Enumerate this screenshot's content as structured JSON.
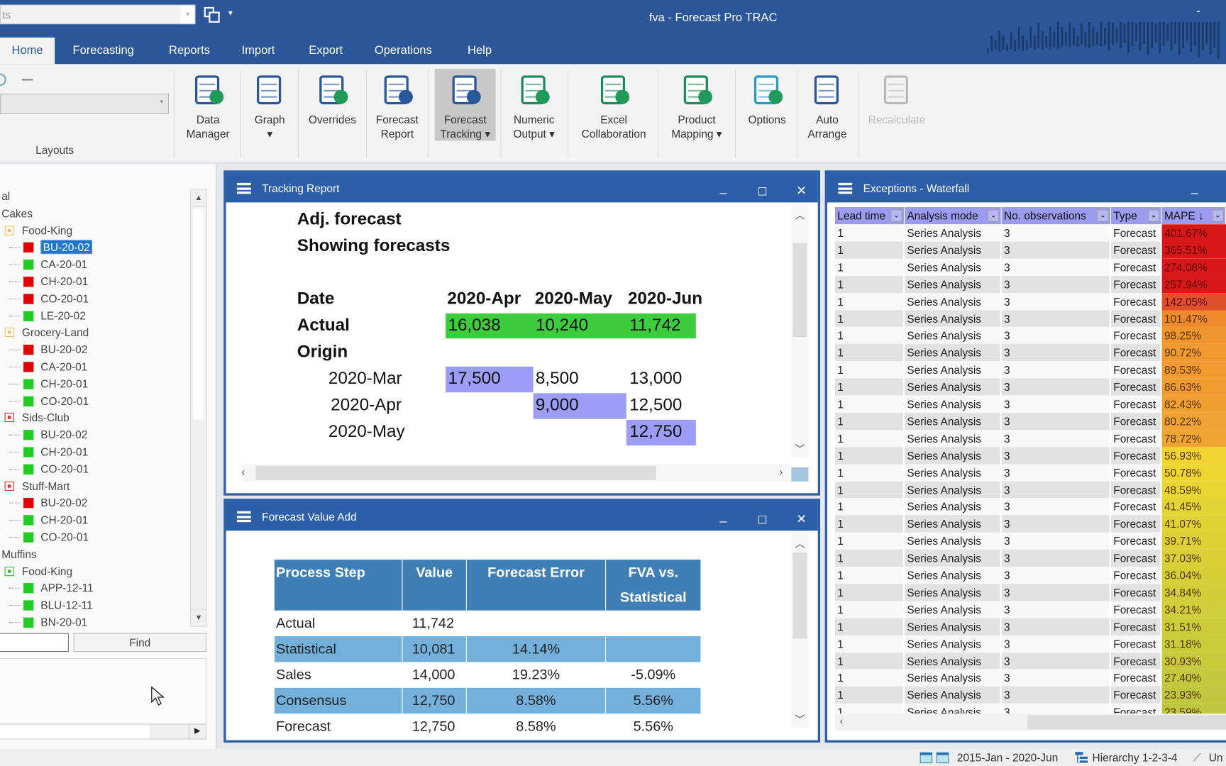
{
  "app": {
    "title": "fva - Forecast Pro TRAC",
    "quick_combo": "ts",
    "minimize": "-"
  },
  "tabs": [
    "Home",
    "Forecasting",
    "Reports",
    "Import",
    "Export",
    "Operations",
    "Help"
  ],
  "ribbon": {
    "group_label": "Layouts",
    "buttons": [
      {
        "l1": "Data",
        "l2": "Manager",
        "icon": "database-add-icon"
      },
      {
        "l1": "Graph",
        "l2": "▾",
        "icon": "bar-chart-icon"
      },
      {
        "l1": "Overrides",
        "l2": "",
        "icon": "table-edit-icon"
      },
      {
        "l1": "Forecast",
        "l2": "Report",
        "icon": "document-info-icon"
      },
      {
        "l1": "Forecast",
        "l2": "Tracking ▾",
        "icon": "table-clock-icon"
      },
      {
        "l1": "Numeric",
        "l2": "Output ▾",
        "icon": "document-arrow-icon"
      },
      {
        "l1": "Excel",
        "l2": "Collaboration",
        "icon": "excel-icon"
      },
      {
        "l1": "Product",
        "l2": "Mapping ▾",
        "icon": "hierarchy-map-icon"
      },
      {
        "l1": "Options",
        "l2": "",
        "icon": "gear-icon"
      },
      {
        "l1": "Auto",
        "l2": "Arrange",
        "icon": "windows-arrange-icon"
      },
      {
        "l1": "Recalculate",
        "l2": "",
        "icon": "refresh-icon"
      }
    ]
  },
  "tree": {
    "items": [
      {
        "label": "al",
        "level": 0,
        "kind": "text"
      },
      {
        "label": "Cakes",
        "level": 0,
        "kind": "text"
      },
      {
        "label": "Food-King",
        "level": 1,
        "kind": "group",
        "color": "#f0c060"
      },
      {
        "label": "BU-20-02",
        "level": 2,
        "kind": "leaf",
        "color": "#e00000",
        "selected": true
      },
      {
        "label": "CA-20-01",
        "level": 2,
        "kind": "leaf",
        "color": "#22cc22"
      },
      {
        "label": "CH-20-01",
        "level": 2,
        "kind": "leaf",
        "color": "#e00000"
      },
      {
        "label": "CO-20-01",
        "level": 2,
        "kind": "leaf",
        "color": "#e00000"
      },
      {
        "label": "LE-20-02",
        "level": 2,
        "kind": "leaf",
        "color": "#22cc22"
      },
      {
        "label": "Grocery-Land",
        "level": 1,
        "kind": "group",
        "color": "#f0c060"
      },
      {
        "label": "BU-20-02",
        "level": 2,
        "kind": "leaf",
        "color": "#e00000"
      },
      {
        "label": "CA-20-01",
        "level": 2,
        "kind": "leaf",
        "color": "#e00000"
      },
      {
        "label": "CH-20-01",
        "level": 2,
        "kind": "leaf",
        "color": "#22cc22"
      },
      {
        "label": "CO-20-01",
        "level": 2,
        "kind": "leaf",
        "color": "#22cc22"
      },
      {
        "label": "Sids-Club",
        "level": 1,
        "kind": "group",
        "color": "#e03030"
      },
      {
        "label": "BU-20-02",
        "level": 2,
        "kind": "leaf",
        "color": "#22cc22"
      },
      {
        "label": "CH-20-01",
        "level": 2,
        "kind": "leaf",
        "color": "#22cc22"
      },
      {
        "label": "CO-20-01",
        "level": 2,
        "kind": "leaf",
        "color": "#22cc22"
      },
      {
        "label": "Stuff-Mart",
        "level": 1,
        "kind": "group",
        "color": "#e03030"
      },
      {
        "label": "BU-20-02",
        "level": 2,
        "kind": "leaf",
        "color": "#e00000"
      },
      {
        "label": "CH-20-01",
        "level": 2,
        "kind": "leaf",
        "color": "#22cc22"
      },
      {
        "label": "CO-20-01",
        "level": 2,
        "kind": "leaf",
        "color": "#22cc22"
      },
      {
        "label": "Muffins",
        "level": 0,
        "kind": "text"
      },
      {
        "label": "Food-King",
        "level": 1,
        "kind": "group",
        "color": "#30c030"
      },
      {
        "label": "APP-12-11",
        "level": 2,
        "kind": "leaf",
        "color": "#22cc22"
      },
      {
        "label": "BLU-12-11",
        "level": 2,
        "kind": "leaf",
        "color": "#22cc22"
      },
      {
        "label": "BN-20-01",
        "level": 2,
        "kind": "leaf",
        "color": "#22cc22"
      }
    ],
    "find_label": "Find",
    "find_value": ""
  },
  "tracking": {
    "title": "Tracking Report",
    "line1": "Adj. forecast",
    "line2": "Showing forecasts",
    "date_label": "Date",
    "dates": [
      "2020-Apr",
      "2020-May",
      "2020-Jun"
    ],
    "actual_label": "Actual",
    "actual": [
      "16,038",
      "10,240",
      "11,742"
    ],
    "origin_label": "Origin",
    "origins": [
      {
        "label": "2020-Mar",
        "values": [
          "17,500",
          "8,500",
          "13,000"
        ]
      },
      {
        "label": "2020-Apr",
        "values": [
          "",
          "9,000",
          "12,500"
        ]
      },
      {
        "label": "2020-May",
        "values": [
          "",
          "",
          "12,750"
        ]
      }
    ]
  },
  "fva": {
    "title": "Forecast Value Add",
    "headers": [
      "Process Step",
      "Value",
      "Forecast Error",
      "FVA vs. Statistical"
    ],
    "rows": [
      [
        "Actual",
        "11,742",
        "",
        ""
      ],
      [
        "Statistical",
        "10,081",
        "14.14%",
        ""
      ],
      [
        "Sales",
        "14,000",
        "19.23%",
        "-5.09%"
      ],
      [
        "Consensus",
        "12,750",
        "8.58%",
        "5.56%"
      ],
      [
        "Forecast",
        "12,750",
        "8.58%",
        "5.56%"
      ]
    ]
  },
  "exceptions": {
    "title": "Exceptions - Waterfall",
    "headers": [
      "Lead time",
      "Analysis mode",
      "No. observations",
      "Type",
      "MAPE ↓"
    ],
    "lead": "1",
    "mode": "Series Analysis",
    "obs": "3",
    "type": "Forecast",
    "mape": [
      {
        "v": "401.67%",
        "c": "#d81818"
      },
      {
        "v": "365.51%",
        "c": "#d81818"
      },
      {
        "v": "274.08%",
        "c": "#d81818"
      },
      {
        "v": "257.94%",
        "c": "#d81818"
      },
      {
        "v": "142.05%",
        "c": "#e0502a"
      },
      {
        "v": "101.47%",
        "c": "#ee8a2c"
      },
      {
        "v": "98.25%",
        "c": "#f0962e"
      },
      {
        "v": "90.72%",
        "c": "#f09a30"
      },
      {
        "v": "89.53%",
        "c": "#f09a30"
      },
      {
        "v": "86.63%",
        "c": "#f09c30"
      },
      {
        "v": "82.43%",
        "c": "#f0a030"
      },
      {
        "v": "80.22%",
        "c": "#f0a232"
      },
      {
        "v": "78.72%",
        "c": "#f0a432"
      },
      {
        "v": "56.93%",
        "c": "#f2d430"
      },
      {
        "v": "50.78%",
        "c": "#eed630"
      },
      {
        "v": "48.59%",
        "c": "#e8d632"
      },
      {
        "v": "41.45%",
        "c": "#e2d434"
      },
      {
        "v": "41.07%",
        "c": "#e0d434"
      },
      {
        "v": "39.71%",
        "c": "#dcd236"
      },
      {
        "v": "37.03%",
        "c": "#d8d036"
      },
      {
        "v": "36.04%",
        "c": "#d6d038"
      },
      {
        "v": "34.84%",
        "c": "#d2ce38"
      },
      {
        "v": "34.21%",
        "c": "#d0ce3a"
      },
      {
        "v": "31.51%",
        "c": "#cccc3a"
      },
      {
        "v": "31.18%",
        "c": "#cacc3a"
      },
      {
        "v": "30.93%",
        "c": "#c8ca3c"
      },
      {
        "v": "27.40%",
        "c": "#c4c83c"
      },
      {
        "v": "23.93%",
        "c": "#c0c63e"
      },
      {
        "v": "23.59%",
        "c": "#bec63e"
      }
    ]
  },
  "status": {
    "range": "2015-Jan - 2020-Jun",
    "hierarchy": "Hierarchy 1-2-3-4",
    "units": "Un"
  }
}
